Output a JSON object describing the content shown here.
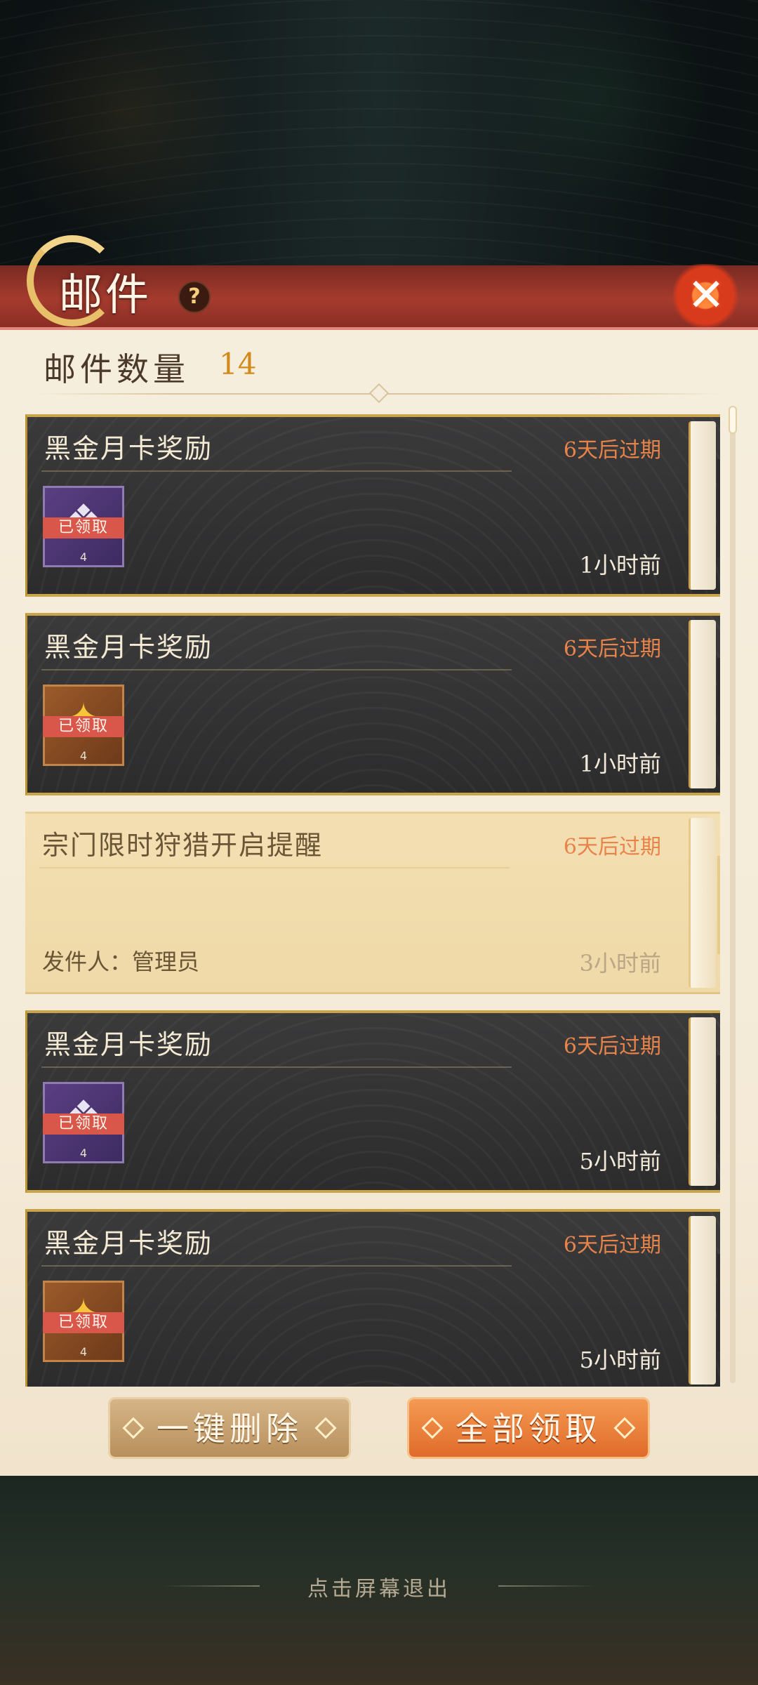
{
  "header": {
    "title": "邮件",
    "help_label": "?",
    "close_icon": "close-icon"
  },
  "summary": {
    "count_label": "邮件数量",
    "count_value": "14"
  },
  "mails": [
    {
      "title": "黑金月卡奖励",
      "expire": "6天后过期",
      "time": "1小时前",
      "item": {
        "icon": "item-icon",
        "color": "purple",
        "status": "已领取",
        "qty": "4"
      }
    },
    {
      "title": "黑金月卡奖励",
      "expire": "6天后过期",
      "time": "1小时前",
      "item": {
        "icon": "item-icon",
        "color": "orange",
        "status": "已领取",
        "qty": "4"
      }
    },
    {
      "title": "宗门限时狩猎开启提醒",
      "expire": "6天后过期",
      "sender": "发件人：管理员",
      "time": "3小时前"
    },
    {
      "title": "黑金月卡奖励",
      "expire": "6天后过期",
      "time": "5小时前",
      "item": {
        "icon": "item-icon",
        "color": "purple",
        "status": "已领取",
        "qty": "4"
      }
    },
    {
      "title": "黑金月卡奖励",
      "expire": "6天后过期",
      "time": "5小时前",
      "item": {
        "icon": "item-icon",
        "color": "orange",
        "status": "已领取",
        "qty": "4"
      }
    }
  ],
  "actions": {
    "delete_all": "一键删除",
    "claim_all": "全部领取"
  },
  "footer": {
    "exit_hint": "点击屏幕退出"
  },
  "colors": {
    "accent_orange": "#e8834a",
    "banner_red": "#a53b2e",
    "panel_bg": "#f6eedd"
  }
}
